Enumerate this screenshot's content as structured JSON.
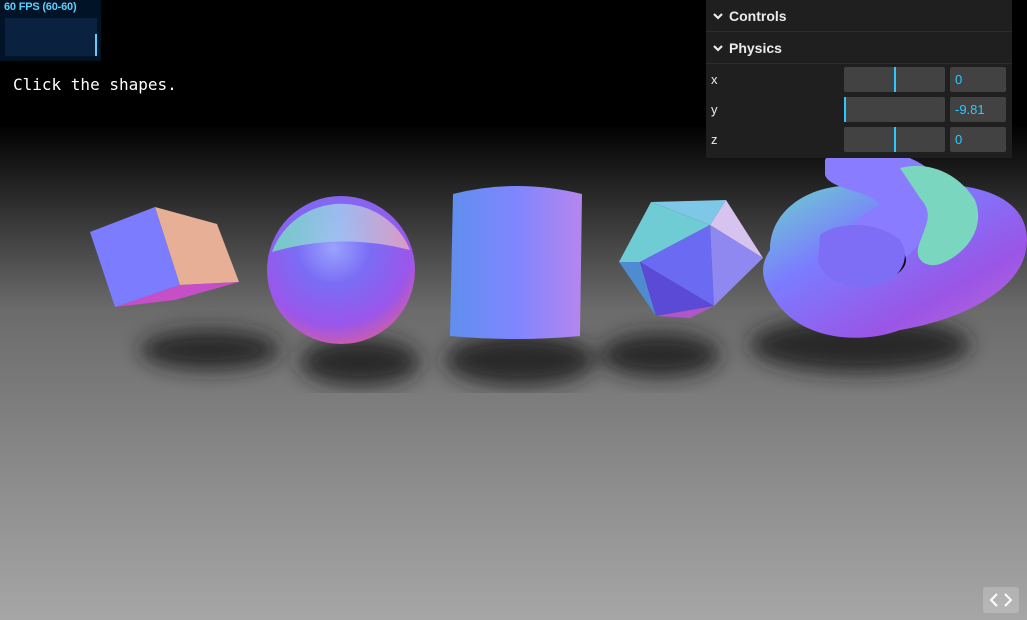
{
  "stats": {
    "fps_label": "60 FPS (60-60)",
    "fps": 60,
    "fps_max": 60
  },
  "instructions": "Click the shapes.",
  "gui": {
    "title": "Controls",
    "folder": "Physics",
    "params": [
      {
        "label": "x",
        "value": "0",
        "fraction": 0.5
      },
      {
        "label": "y",
        "value": "-9.81",
        "fraction": 0.0
      },
      {
        "label": "z",
        "value": "0",
        "fraction": 0.5
      }
    ]
  },
  "icons": {
    "fold": "chevron-down-icon",
    "code": "code-icon"
  },
  "colors": {
    "accent": "#2cc9ff",
    "panel": "#1f1f1f",
    "fps": "#5ad0ff"
  }
}
